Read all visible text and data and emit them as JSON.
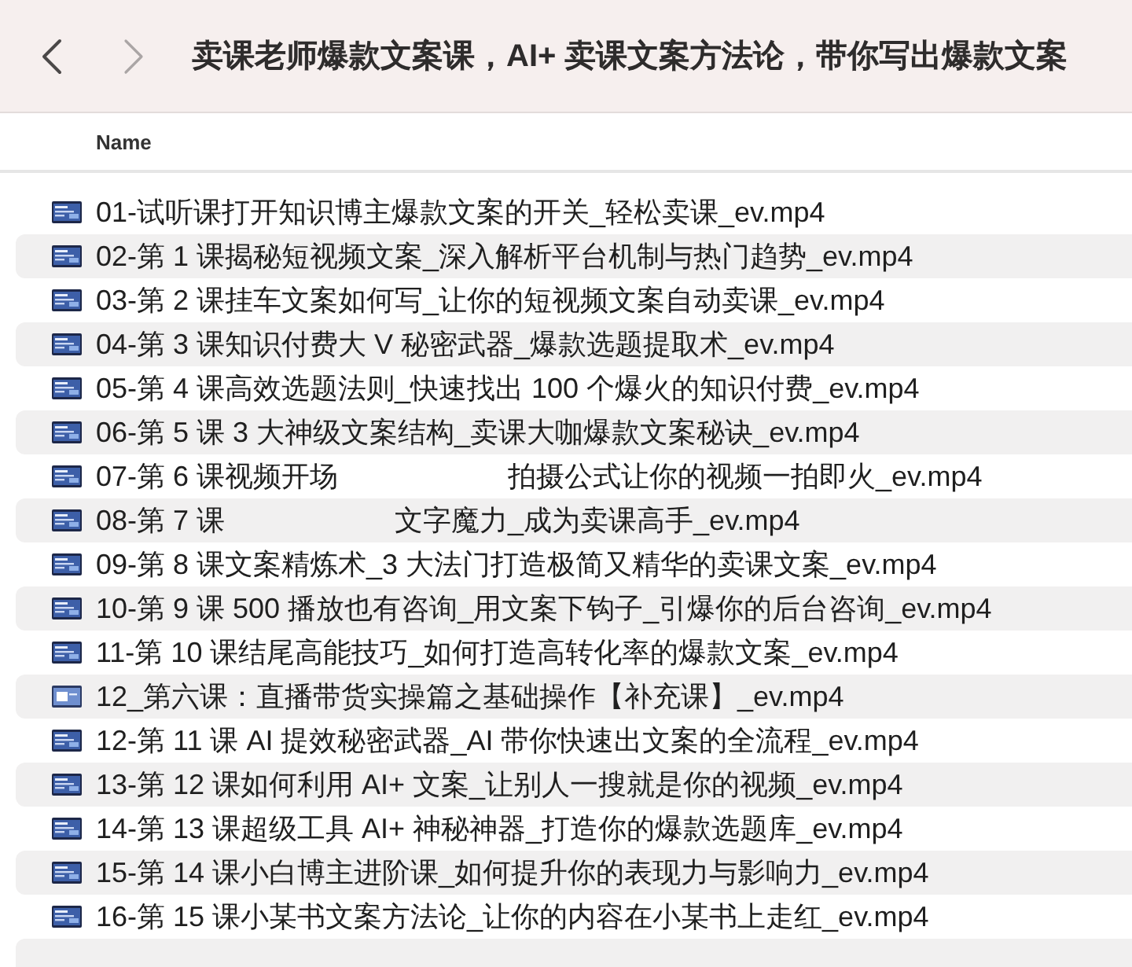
{
  "toolbar": {
    "back": {
      "disabled": false
    },
    "forward": {
      "disabled": true
    },
    "title": "卖课老师爆款文案课，AI+ 卖课文案方法论，带你写出爆款文案"
  },
  "table": {
    "columns": [
      "Name"
    ],
    "rows": [
      {
        "kind": "dark",
        "parts": [
          "01-试听课打开知识博主爆款文案的开关_轻松卖课_ev.mp4"
        ]
      },
      {
        "kind": "dark",
        "parts": [
          "02-第 1 课揭秘短视频文案_深入解析平台机制与热门趋势_ev.mp4"
        ]
      },
      {
        "kind": "dark",
        "parts": [
          "03-第 2 课挂车文案如何写_让你的短视频文案自动卖课_ev.mp4"
        ]
      },
      {
        "kind": "dark",
        "parts": [
          "04-第 3 课知识付费大 V 秘密武器_爆款选题提取术_ev.mp4"
        ]
      },
      {
        "kind": "dark",
        "parts": [
          "05-第 4 课高效选题法则_快速找出 100 个爆火的知识付费_ev.mp4"
        ]
      },
      {
        "kind": "dark",
        "parts": [
          "06-第 5 课 3 大神级文案结构_卖课大咖爆款文案秘诀_ev.mp4"
        ]
      },
      {
        "kind": "dark",
        "parts": [
          "07-第 6 课视频开场",
          "拍摄公式让你的视频一拍即火_ev.mp4"
        ]
      },
      {
        "kind": "dark",
        "parts": [
          "08-第 7 课",
          "文字魔力_成为卖课高手_ev.mp4"
        ]
      },
      {
        "kind": "dark",
        "parts": [
          "09-第 8 课文案精炼术_3 大法门打造极简又精华的卖课文案_ev.mp4"
        ]
      },
      {
        "kind": "dark",
        "parts": [
          "10-第 9 课 500 播放也有咨询_用文案下钩子_引爆你的后台咨询_ev.mp4"
        ]
      },
      {
        "kind": "dark",
        "parts": [
          "11-第 10 课结尾高能技巧_如何打造高转化率的爆款文案_ev.mp4"
        ]
      },
      {
        "kind": "light",
        "parts": [
          "12_第六课：直播带货实操篇之基础操作【补充课】_ev.mp4"
        ]
      },
      {
        "kind": "dark",
        "parts": [
          "12-第 11 课 AI 提效秘密武器_AI 带你快速出文案的全流程_ev.mp4"
        ]
      },
      {
        "kind": "dark",
        "parts": [
          "13-第 12 课如何利用 AI+ 文案_让别人一搜就是你的视频_ev.mp4"
        ]
      },
      {
        "kind": "dark",
        "parts": [
          "14-第 13 课超级工具 AI+ 神秘神器_打造你的爆款选题库_ev.mp4"
        ]
      },
      {
        "kind": "dark",
        "parts": [
          "15-第 14 课小白博主进阶课_如何提升你的表现力与影响力_ev.mp4"
        ]
      },
      {
        "kind": "dark",
        "parts": [
          "16-第 15 课小某书文案方法论_让你的内容在小某书上走红_ev.mp4"
        ]
      }
    ]
  }
}
